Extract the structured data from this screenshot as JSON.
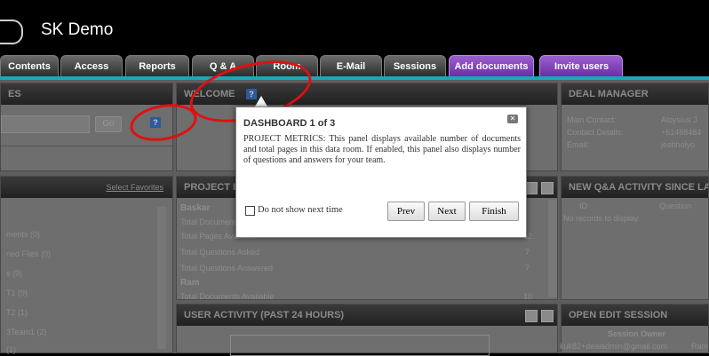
{
  "app": {
    "title": "SK Demo"
  },
  "nav": {
    "tabs": [
      {
        "label": "Contents"
      },
      {
        "label": "Access"
      },
      {
        "label": "Reports"
      },
      {
        "label": "Q & A"
      },
      {
        "label": "Room"
      },
      {
        "label": "E-Mail"
      },
      {
        "label": "Sessions"
      },
      {
        "label": "Add documents"
      },
      {
        "label": "Invite users"
      }
    ]
  },
  "panels": {
    "files": {
      "title": "ES",
      "go_label": "Go",
      "help_icon": "question-icon",
      "list_link": "Select Favorites",
      "items": [
        "ments (0)",
        "ned Files (0)",
        "s (9)",
        "T1 (9)",
        "T2 (1)",
        "3Team1 (2)",
        "(1)"
      ]
    },
    "welcome": {
      "title": "WELCOME",
      "help_icon": "question-icon"
    },
    "deal_manager": {
      "title": "DEAL MANAGER",
      "rows": [
        {
          "label": "Main Contact:",
          "value": "Aloysius J"
        },
        {
          "label": "Contact Details:",
          "value": "+61488484"
        },
        {
          "label": "Email:",
          "value": "jesbholyo"
        }
      ]
    },
    "project_metrics": {
      "title": "PROJECT I",
      "rows": [
        {
          "label": "Baskar",
          "value": ""
        },
        {
          "label": "Total Document",
          "value": ""
        },
        {
          "label": "Total Pages Available",
          "value": "62"
        },
        {
          "label": "Total Questions Asked",
          "value": "7"
        },
        {
          "label": "Total Questions Answered",
          "value": "7"
        },
        {
          "label": "Ram",
          "value": ""
        },
        {
          "label": "Total Documents Available",
          "value": "10"
        }
      ]
    },
    "qa_activity": {
      "title": "NEW Q&A ACTIVITY SINCE LA",
      "col_id": "ID",
      "col_question": "Question",
      "empty_text": "No records to display."
    },
    "user_activity": {
      "title": "USER ACTIVITY (PAST 24 HOURS)"
    },
    "open_edit": {
      "title": "OPEN EDIT SESSION",
      "col_owner": "Session Owner",
      "owner_value": "kuk82+dealadmin@gmail.com",
      "trail": "Ram"
    }
  },
  "modal": {
    "title": "DASHBOARD 1 of 3",
    "body": "PROJECT METRICS: This panel displays available number of documents and total pages in this data room. If enabled, this panel also displays number of questions and answers for your team.",
    "checkbox_label": "Do not show next time",
    "prev_label": "Prev",
    "next_label": "Next",
    "finish_label": "Finish",
    "close_icon": "close-icon"
  },
  "colors": {
    "accent": "#1ea6b8",
    "purple_tab": "#7b3fb5",
    "annotation": "#e01010"
  }
}
